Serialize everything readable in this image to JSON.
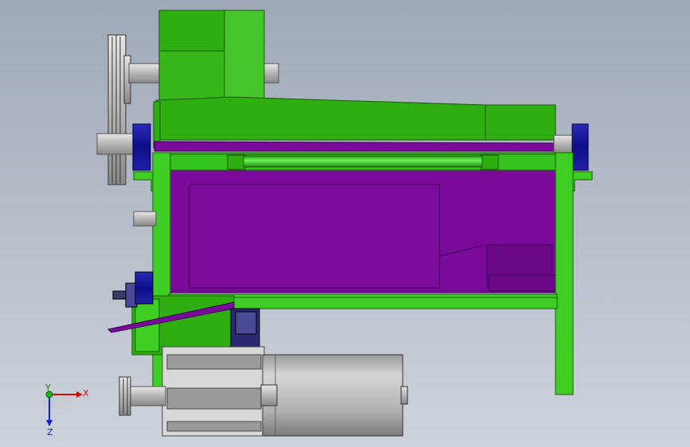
{
  "viewport": {
    "background_top": "#9fa8b6",
    "background_bottom": "#cdd3dc"
  },
  "colors": {
    "frame_green": "#3fcf24",
    "body_green": "#2fae12",
    "purple": "#7a0a99",
    "blue": "#1a1a9a",
    "steel": "#b8b8b8"
  },
  "triad": {
    "x_label": "X",
    "y_label": "Y",
    "z_label": "Z"
  }
}
